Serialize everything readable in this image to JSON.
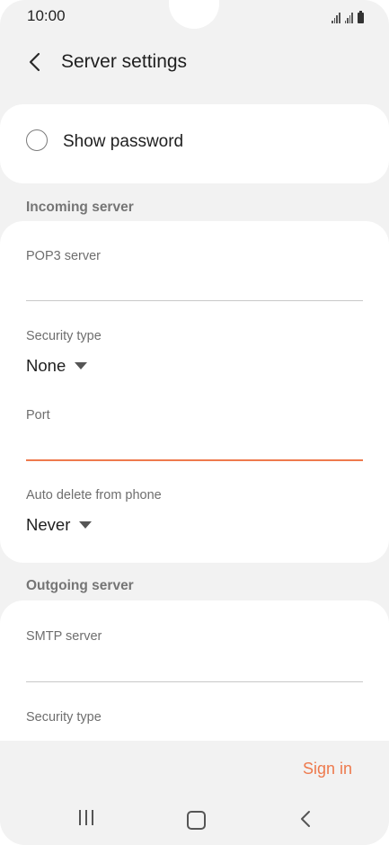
{
  "status_bar": {
    "time": "10:00"
  },
  "app_bar": {
    "title": "Server settings"
  },
  "show_password": {
    "label": "Show password",
    "checked": false
  },
  "incoming": {
    "header": "Incoming server",
    "pop3_label": "POP3 server",
    "pop3_value": "",
    "security_label": "Security type",
    "security_value": "None",
    "port_label": "Port",
    "port_value": "",
    "auto_delete_label": "Auto delete from phone",
    "auto_delete_value": "Never"
  },
  "outgoing": {
    "header": "Outgoing server",
    "smtp_label": "SMTP server",
    "smtp_value": "",
    "security_label": "Security type"
  },
  "actions": {
    "sign_in": "Sign in"
  },
  "colors": {
    "accent": "#ee7a4d",
    "background": "#f2f2f2",
    "card": "#ffffff"
  }
}
